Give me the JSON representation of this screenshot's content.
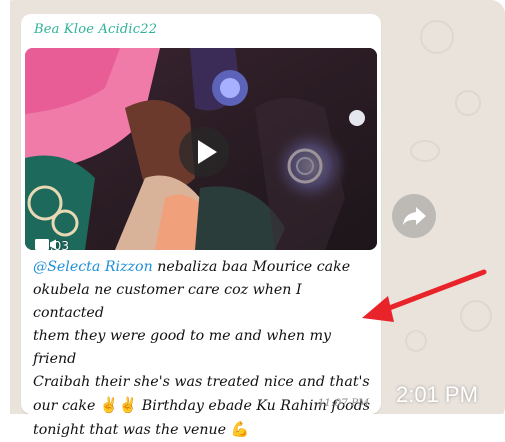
{
  "chat": {
    "sender_name": "Bea Kloe Acidic22",
    "sender_color": "#2fb398",
    "video": {
      "duration": "0:03",
      "play_icon": "play-icon",
      "type_icon": "video-camera-icon"
    },
    "caption": {
      "mention": "@Selecta Rizzon",
      "line1_rest": " nebaliza baa Mourice cake",
      "line2": "okubela ne customer care coz when I contacted",
      "line3": "them they were good to me and when my friend",
      "line4": "Craibah their she's was treated nice and that's",
      "line5_start": "our cake ",
      "emoji_victory_1": "✌️",
      "emoji_victory_2": "✌️",
      "line5_end": " Birthday ebade Ku Rahim foods",
      "line6": "tonight that was the venue ",
      "emoji_flex": "💪"
    },
    "message_time": "11:07 PM",
    "forward_icon": "forward-icon",
    "mention_color": "#1f8fd6"
  },
  "overlay": {
    "clock": "2:01 PM",
    "arrow_color": "#e8232a"
  }
}
